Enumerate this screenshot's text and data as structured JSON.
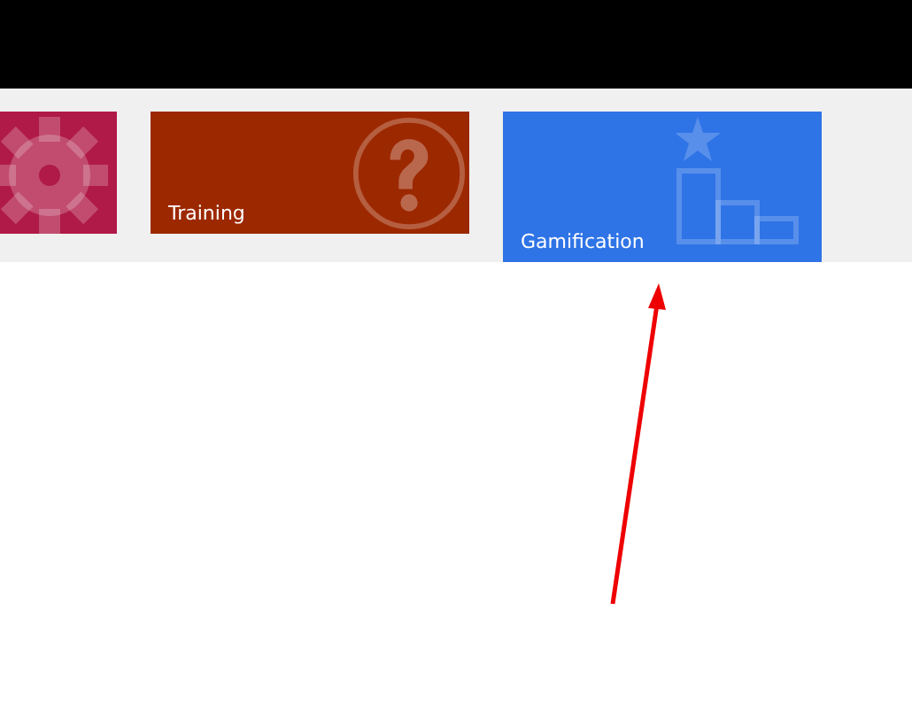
{
  "tiles": [
    {
      "kind": "gear",
      "color": "#b01a48",
      "selected": false
    },
    {
      "kind": "question",
      "label": "Training",
      "color": "#9c2800",
      "selected": false
    },
    {
      "kind": "podium",
      "label": "Gamification",
      "color": "#2f74e6",
      "selected": true
    }
  ]
}
